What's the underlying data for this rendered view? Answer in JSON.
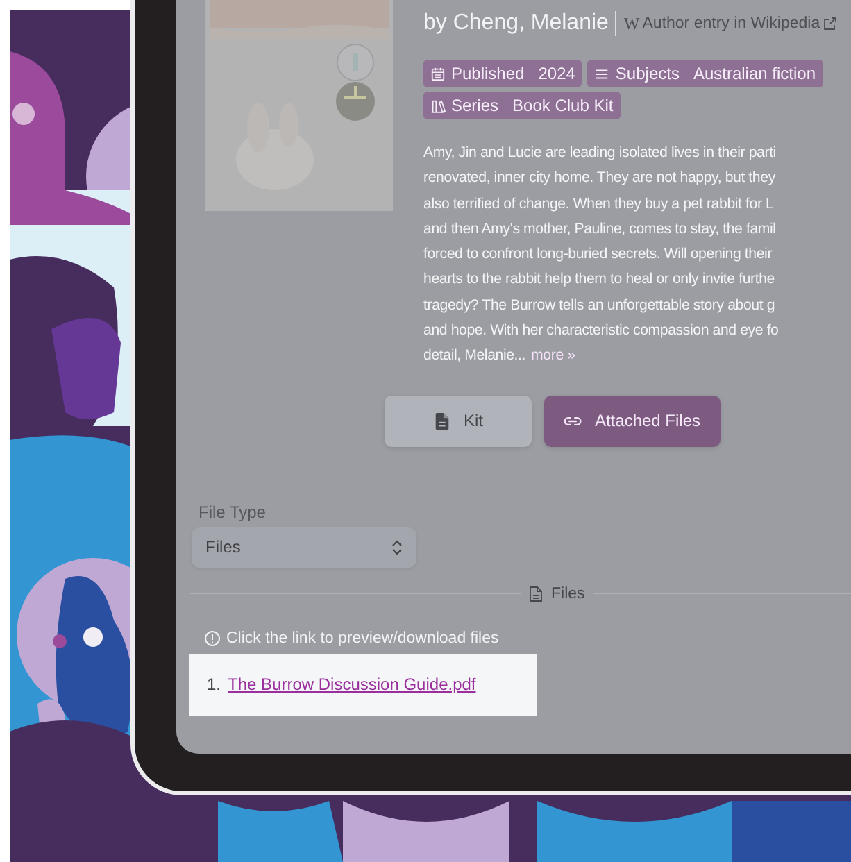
{
  "book": {
    "author": "by Cheng, Melanie",
    "author_link": {
      "icon": "W",
      "label": "Author entry in Wikipedia"
    },
    "tags": [
      {
        "kind": "calendar",
        "label": "Published",
        "value": "2024"
      },
      {
        "kind": "list",
        "label": "Subjects",
        "value": "Australian fiction"
      },
      {
        "kind": "series",
        "label": "Series",
        "value": "Book Club Kit"
      }
    ],
    "description_lines": [
      "Amy, Jin and Lucie are leading isolated lives in their parti",
      "renovated, inner city home. They are not happy, but they",
      "also terrified of change. When they buy a pet rabbit for L",
      "and then Amy's mother, Pauline, comes to stay, the famil",
      "forced to confront long-buried secrets. Will opening their",
      "hearts to the rabbit help them to heal or only invite furthe",
      "tragedy? The Burrow tells an unforgettable story about g",
      "and hope. With her characteristic compassion and eye fo",
      "detail, Melanie..."
    ],
    "more_link": "more »"
  },
  "tabs": [
    {
      "label": "Kit",
      "selected": false
    },
    {
      "label": "Attached Files",
      "selected": true
    }
  ],
  "file_type": {
    "label": "File Type",
    "value": "Files"
  },
  "section_heading": "Files",
  "hint": "Click the link to preview/download files",
  "files": [
    {
      "number": "1.",
      "name": "The Burrow Discussion Guide.pdf",
      "highlighted": true
    }
  ]
}
